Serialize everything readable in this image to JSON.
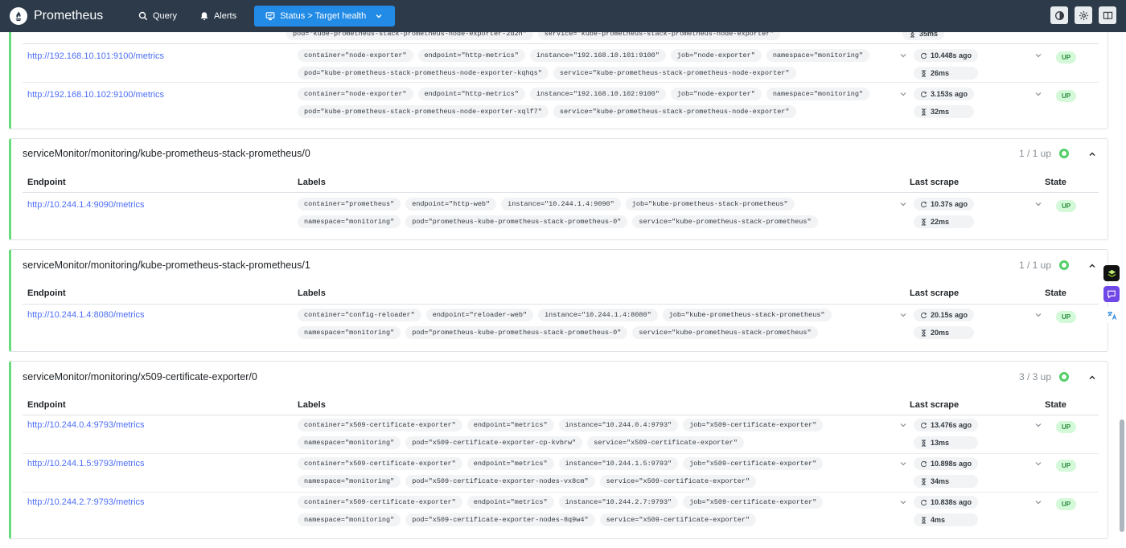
{
  "header": {
    "brand": "Prometheus",
    "nav": [
      {
        "label": "Query",
        "icon": "search-icon"
      },
      {
        "label": "Alerts",
        "icon": "bell-icon"
      },
      {
        "label": "Status > Target health",
        "icon": "monitor-icon"
      }
    ]
  },
  "columns": {
    "endpoint": "Endpoint",
    "labels": "Labels",
    "last_scrape": "Last scrape",
    "state": "State"
  },
  "partial": {
    "top_labels": [
      "pod=\"kube-prometheus-stack-prometheus-node-exporter-2d2h\"",
      "service=\"kube-prometheus-stack-prometheus-node-exporter\""
    ],
    "top_duration": "35ms",
    "rows": [
      {
        "endpoint": "http://192.168.10.101:9100/metrics",
        "labels": [
          "container=\"node-exporter\"",
          "endpoint=\"http-metrics\"",
          "instance=\"192.168.10.101:9100\"",
          "job=\"node-exporter\"",
          "namespace=\"monitoring\"",
          "pod=\"kube-prometheus-stack-prometheus-node-exporter-kqhqs\"",
          "service=\"kube-prometheus-stack-prometheus-node-exporter\""
        ],
        "ago": "10.448s ago",
        "duration": "26ms",
        "state": "UP"
      },
      {
        "endpoint": "http://192.168.10.102:9100/metrics",
        "labels": [
          "container=\"node-exporter\"",
          "endpoint=\"http-metrics\"",
          "instance=\"192.168.10.102:9100\"",
          "job=\"node-exporter\"",
          "namespace=\"monitoring\"",
          "pod=\"kube-prometheus-stack-prometheus-node-exporter-xqlf7\"",
          "service=\"kube-prometheus-stack-prometheus-node-exporter\""
        ],
        "ago": "3.153s ago",
        "duration": "32ms",
        "state": "UP"
      }
    ]
  },
  "pools": [
    {
      "title": "serviceMonitor/monitoring/kube-prometheus-stack-prometheus/0",
      "up": "1 / 1 up",
      "rows": [
        {
          "endpoint": "http://10.244.1.4:9090/metrics",
          "labels": [
            "container=\"prometheus\"",
            "endpoint=\"http-web\"",
            "instance=\"10.244.1.4:9090\"",
            "job=\"kube-prometheus-stack-prometheus\"",
            "namespace=\"monitoring\"",
            "pod=\"prometheus-kube-prometheus-stack-prometheus-0\"",
            "service=\"kube-prometheus-stack-prometheus\""
          ],
          "ago": "10.37s ago",
          "duration": "22ms",
          "state": "UP"
        }
      ]
    },
    {
      "title": "serviceMonitor/monitoring/kube-prometheus-stack-prometheus/1",
      "up": "1 / 1 up",
      "rows": [
        {
          "endpoint": "http://10.244.1.4:8080/metrics",
          "labels": [
            "container=\"config-reloader\"",
            "endpoint=\"reloader-web\"",
            "instance=\"10.244.1.4:8080\"",
            "job=\"kube-prometheus-stack-prometheus\"",
            "namespace=\"monitoring\"",
            "pod=\"prometheus-kube-prometheus-stack-prometheus-0\"",
            "service=\"kube-prometheus-stack-prometheus\""
          ],
          "ago": "20.15s ago",
          "duration": "20ms",
          "state": "UP"
        }
      ]
    },
    {
      "title": "serviceMonitor/monitoring/x509-certificate-exporter/0",
      "up": "3 / 3 up",
      "rows": [
        {
          "endpoint": "http://10.244.0.4:9793/metrics",
          "labels": [
            "container=\"x509-certificate-exporter\"",
            "endpoint=\"metrics\"",
            "instance=\"10.244.0.4:9793\"",
            "job=\"x509-certificate-exporter\"",
            "namespace=\"monitoring\"",
            "pod=\"x509-certificate-exporter-cp-kvbrw\"",
            "service=\"x509-certificate-exporter\""
          ],
          "ago": "13.476s ago",
          "duration": "13ms",
          "state": "UP"
        },
        {
          "endpoint": "http://10.244.1.5:9793/metrics",
          "labels": [
            "container=\"x509-certificate-exporter\"",
            "endpoint=\"metrics\"",
            "instance=\"10.244.1.5:9793\"",
            "job=\"x509-certificate-exporter\"",
            "namespace=\"monitoring\"",
            "pod=\"x509-certificate-exporter-nodes-vx8cm\"",
            "service=\"x509-certificate-exporter\""
          ],
          "ago": "10.898s ago",
          "duration": "34ms",
          "state": "UP"
        },
        {
          "endpoint": "http://10.244.2.7:9793/metrics",
          "labels": [
            "container=\"x509-certificate-exporter\"",
            "endpoint=\"metrics\"",
            "instance=\"10.244.2.7:9793\"",
            "job=\"x509-certificate-exporter\"",
            "namespace=\"monitoring\"",
            "pod=\"x509-certificate-exporter-nodes-8q9w4\"",
            "service=\"x509-certificate-exporter\""
          ],
          "ago": "10.838s ago",
          "duration": "4ms",
          "state": "UP"
        }
      ]
    }
  ],
  "colors": {
    "header_bg": "#2c3a4a",
    "accent": "#228be6",
    "up_green": "#51cf66",
    "link": "#4c6ef5"
  }
}
